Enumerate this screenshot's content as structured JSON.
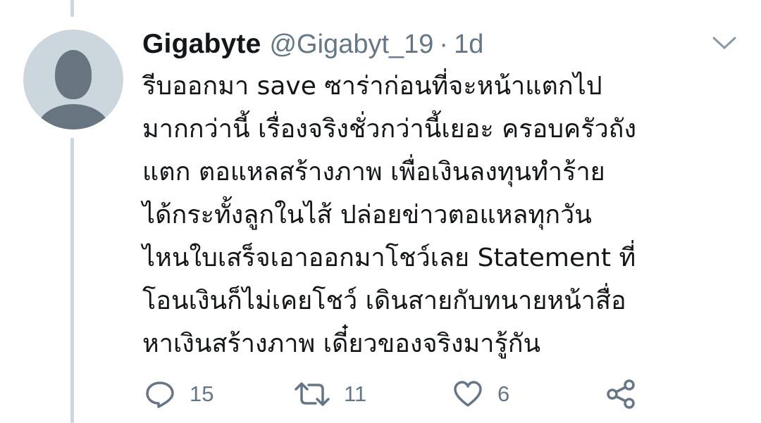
{
  "tweet": {
    "display_name": "Gigabyte",
    "handle": "@Gigabyt_19",
    "separator": "·",
    "time": "1d",
    "text_lines": [
      "รีบออกมา save ซาร่าก่อนที่จะหน้าแตกไป",
      "มากกว่านี้ เรื่องจริงชั่วกว่านี้เยอะ ครอบครัวถัง",
      "แตก ตอแหลสร้างภาพ เพื่อเงินลงทุนทำร้าย",
      "ได้กระทั้งลูกในไส้ ปล่อยข่าวตอแหลทุกวัน",
      "ไหนใบเสร็จเอาออกมาโชว์เลย Statement ที่",
      "โอนเงินก็ไม่เคยโชว์ เดินสายกับทนายหน้าสื่อ",
      "หาเงินสร้างภาพ เดี๋ยวของจริงมารู้กัน"
    ],
    "stats": {
      "replies": "15",
      "retweets": "11",
      "likes": "6"
    }
  },
  "icons": {
    "avatar": "default-profile-avatar",
    "menu": "chevron-down-icon",
    "reply": "reply-icon",
    "retweet": "retweet-icon",
    "like": "heart-icon",
    "share": "share-icon"
  },
  "colors": {
    "text_primary": "#14171a",
    "text_secondary": "#657786",
    "avatar_bg": "#ccd6dd",
    "avatar_fg": "#66757f",
    "thread_line": "#ccd6dd",
    "background": "#ffffff"
  }
}
